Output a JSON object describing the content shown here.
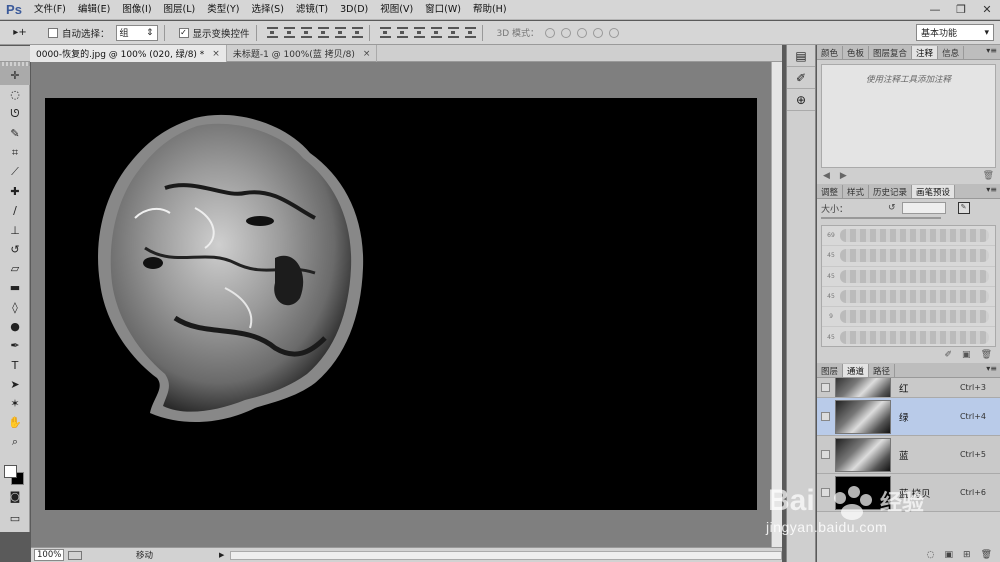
{
  "app": {
    "logo": "Ps"
  },
  "menu": [
    "文件(F)",
    "编辑(E)",
    "图像(I)",
    "图层(L)",
    "类型(Y)",
    "选择(S)",
    "滤镜(T)",
    "3D(D)",
    "视图(V)",
    "窗口(W)",
    "帮助(H)"
  ],
  "window_controls": {
    "minimize": "—",
    "restore": "❐",
    "close": "✕"
  },
  "options": {
    "tool": "▸+",
    "auto_select_label": "自动选择：",
    "auto_select_value": "组",
    "show_transform_label": "显示变换控件",
    "show_transform_checked": "✓",
    "mode_3d_label": "3D 模式：",
    "workspace": "基本功能"
  },
  "doc_tabs": [
    {
      "label": "0000-恢复的.jpg @ 100% (020, 绿/8) *",
      "close": "×"
    },
    {
      "label": "未标题-1 @ 100%(蓝 拷贝/8)",
      "close": "×"
    }
  ],
  "status": {
    "zoom": "100%",
    "text": "移动",
    "arrow": "▶"
  },
  "panels": {
    "top_tabs": [
      "颜色",
      "色板",
      "图层复合",
      "注释",
      "信息"
    ],
    "notes_placeholder": "使用注释工具添加注释",
    "mid_tabs": [
      "调整",
      "样式",
      "历史记录",
      "画笔预设"
    ],
    "brush_size_label": "大小：",
    "brush_sizes": [
      "69",
      "45",
      "45",
      "45",
      "9",
      "45"
    ],
    "bottom_tabs": [
      "图层",
      "通道",
      "路径"
    ]
  },
  "channels": [
    {
      "name": "红",
      "shortcut": "Ctrl+3"
    },
    {
      "name": "绿",
      "shortcut": "Ctrl+4"
    },
    {
      "name": "蓝",
      "shortcut": "Ctrl+5"
    },
    {
      "name": "蓝 拷贝",
      "shortcut": "Ctrl+6"
    }
  ],
  "watermark": {
    "text": "jingyan.baidu.com"
  },
  "colors": {
    "accent": "#b9cbe9",
    "canvas": "#000000",
    "foreground": "#ffffff",
    "background": "#000000"
  }
}
